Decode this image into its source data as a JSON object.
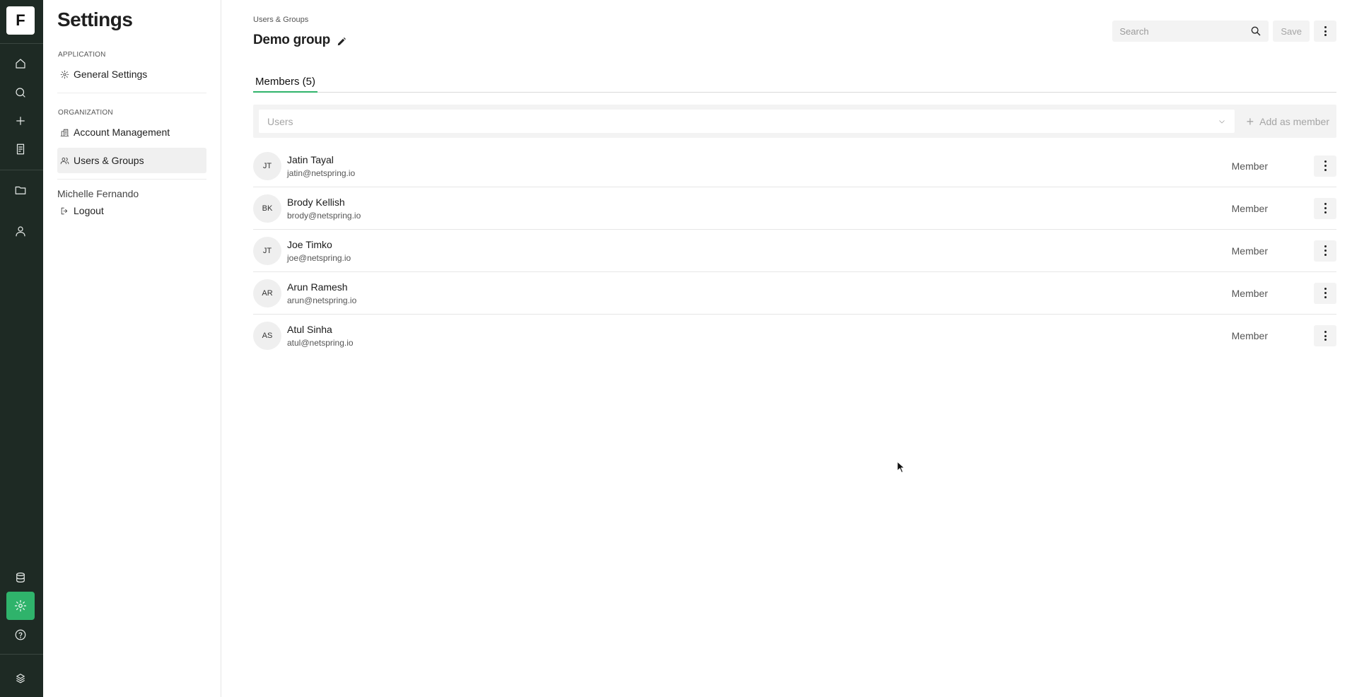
{
  "rail": {
    "logo_letter": "F",
    "top_icons": [
      "home-icon",
      "search-icon",
      "plus-icon",
      "notebook-icon",
      "folder-icon",
      "user-icon"
    ],
    "bottom_icons": [
      "database-icon",
      "gear-icon",
      "help-icon"
    ],
    "brand_icon": "brand-mark-icon"
  },
  "nav": {
    "title": "Settings",
    "section_application": "APPLICATION",
    "general_settings": "General Settings",
    "section_organization": "ORGANIZATION",
    "account_management": "Account Management",
    "users_groups": "Users & Groups",
    "user_name": "Michelle Fernando",
    "logout": "Logout"
  },
  "header": {
    "breadcrumb": "Users & Groups",
    "title": "Demo group",
    "search_placeholder": "Search",
    "save_label": "Save"
  },
  "tabs": [
    {
      "label": "Members (5)",
      "active": true
    }
  ],
  "add_bar": {
    "users_placeholder": "Users",
    "add_label": "Add as member"
  },
  "members": [
    {
      "initials": "JT",
      "name": "Jatin Tayal",
      "email": "jatin@netspring.io",
      "role": "Member"
    },
    {
      "initials": "BK",
      "name": "Brody Kellish",
      "email": "brody@netspring.io",
      "role": "Member"
    },
    {
      "initials": "JT",
      "name": "Joe Timko",
      "email": "joe@netspring.io",
      "role": "Member"
    },
    {
      "initials": "AR",
      "name": "Arun Ramesh",
      "email": "arun@netspring.io",
      "role": "Member"
    },
    {
      "initials": "AS",
      "name": "Atul Sinha",
      "email": "atul@netspring.io",
      "role": "Member"
    }
  ],
  "colors": {
    "rail_bg": "#1e2a24",
    "accent": "#2fb36b",
    "active_nav_bg": "#f0f0f0"
  }
}
